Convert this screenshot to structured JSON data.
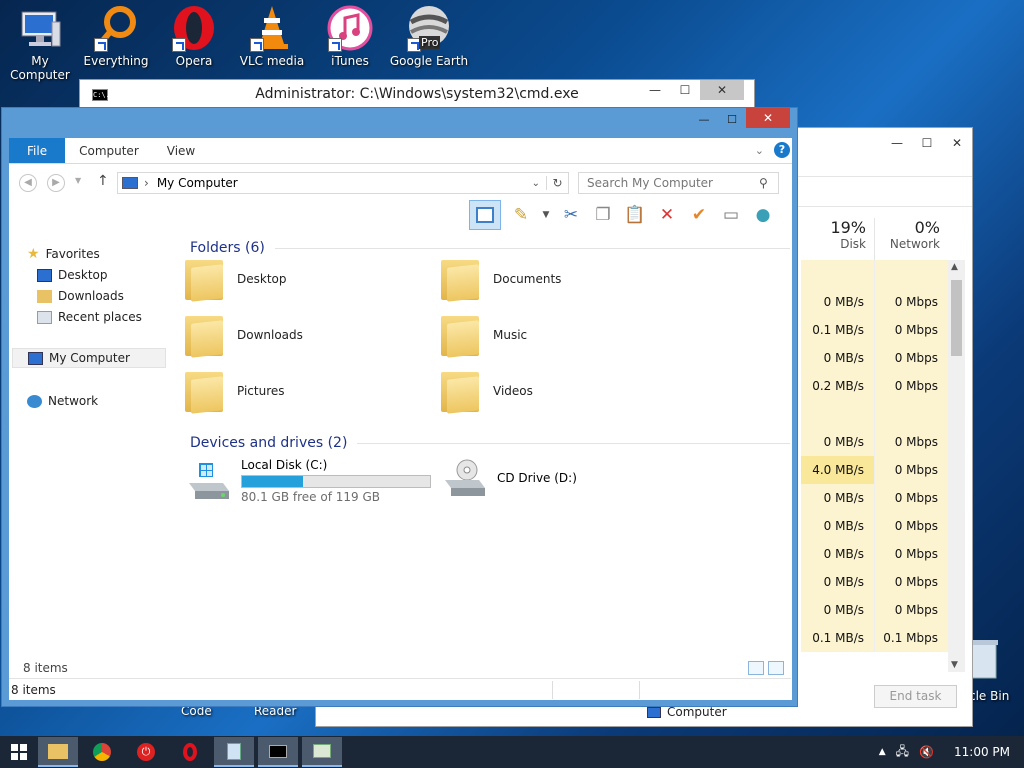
{
  "desktop": {
    "icons": [
      {
        "label": "My Computer",
        "icon": "computer-icon"
      },
      {
        "label": "Everything",
        "icon": "magnifier-icon"
      },
      {
        "label": "Opera",
        "icon": "opera-icon"
      },
      {
        "label": "VLC media",
        "icon": "vlc-cone-icon"
      },
      {
        "label": "iTunes",
        "icon": "itunes-icon"
      },
      {
        "label": "Google Earth",
        "icon": "google-earth-icon"
      }
    ],
    "partial_labels": {
      "code": "Code",
      "reader": "Reader",
      "recycle": "cle Bin"
    },
    "earth_badge": "Pro"
  },
  "cmd": {
    "title": "Administrator: C:\\Windows\\system32\\cmd.exe",
    "icon_text": "C:\\."
  },
  "task_manager": {
    "headers": [
      {
        "percent": "19%",
        "label": "Disk"
      },
      {
        "percent": "0%",
        "label": "Network"
      }
    ],
    "rows": [
      {
        "disk": "",
        "net": ""
      },
      {
        "disk": "0 MB/s",
        "net": "0 Mbps"
      },
      {
        "disk": "0.1 MB/s",
        "net": "0 Mbps"
      },
      {
        "disk": "0 MB/s",
        "net": "0 Mbps"
      },
      {
        "disk": "0.2 MB/s",
        "net": "0 Mbps"
      },
      {
        "disk": "",
        "net": ""
      },
      {
        "disk": "0 MB/s",
        "net": "0 Mbps"
      },
      {
        "disk": "4.0 MB/s",
        "net": "0 Mbps"
      },
      {
        "disk": "0 MB/s",
        "net": "0 Mbps"
      },
      {
        "disk": "0 MB/s",
        "net": "0 Mbps"
      },
      {
        "disk": "0 MB/s",
        "net": "0 Mbps"
      },
      {
        "disk": "0 MB/s",
        "net": "0 Mbps"
      },
      {
        "disk": "0 MB/s",
        "net": "0 Mbps"
      },
      {
        "disk": "0.1 MB/s",
        "net": "0.1 Mbps"
      }
    ],
    "end_task": "End task"
  },
  "explorer": {
    "tabs": [
      "File",
      "Computer",
      "View"
    ],
    "address": "My Computer",
    "search_placeholder": "Search My Computer",
    "nav": {
      "favorites": "Favorites",
      "desktop": "Desktop",
      "downloads": "Downloads",
      "recent": "Recent places",
      "my_computer": "My Computer",
      "network": "Network"
    },
    "folders_header": "Folders (6)",
    "folders": [
      {
        "name": "Desktop",
        "badge": "#3a6fc7"
      },
      {
        "name": "Documents",
        "badge": "#d9dfe8"
      },
      {
        "name": "Downloads",
        "badge": "#2f86d8"
      },
      {
        "name": "Music",
        "badge": "#2a7bd0"
      },
      {
        "name": "Pictures",
        "badge": "#6fa37a"
      },
      {
        "name": "Videos",
        "badge": "#3b5a7a"
      }
    ],
    "drives_header": "Devices and drives (2)",
    "drives": [
      {
        "name": "Local Disk (C:)",
        "free": "80.1 GB free of 119 GB",
        "used_fraction": 0.327
      },
      {
        "name": "CD Drive (D:)"
      }
    ],
    "item_count": "8 items",
    "status_count": "8 items",
    "status_location": "Computer"
  },
  "taskbar": {
    "time": "11:00 PM"
  },
  "colors": {
    "accent": "#1979ca",
    "taskmgr_highlight": "#fcf3d0",
    "taskmgr_highlight_strong": "#f9e79a",
    "close_red": "#c8433b"
  }
}
